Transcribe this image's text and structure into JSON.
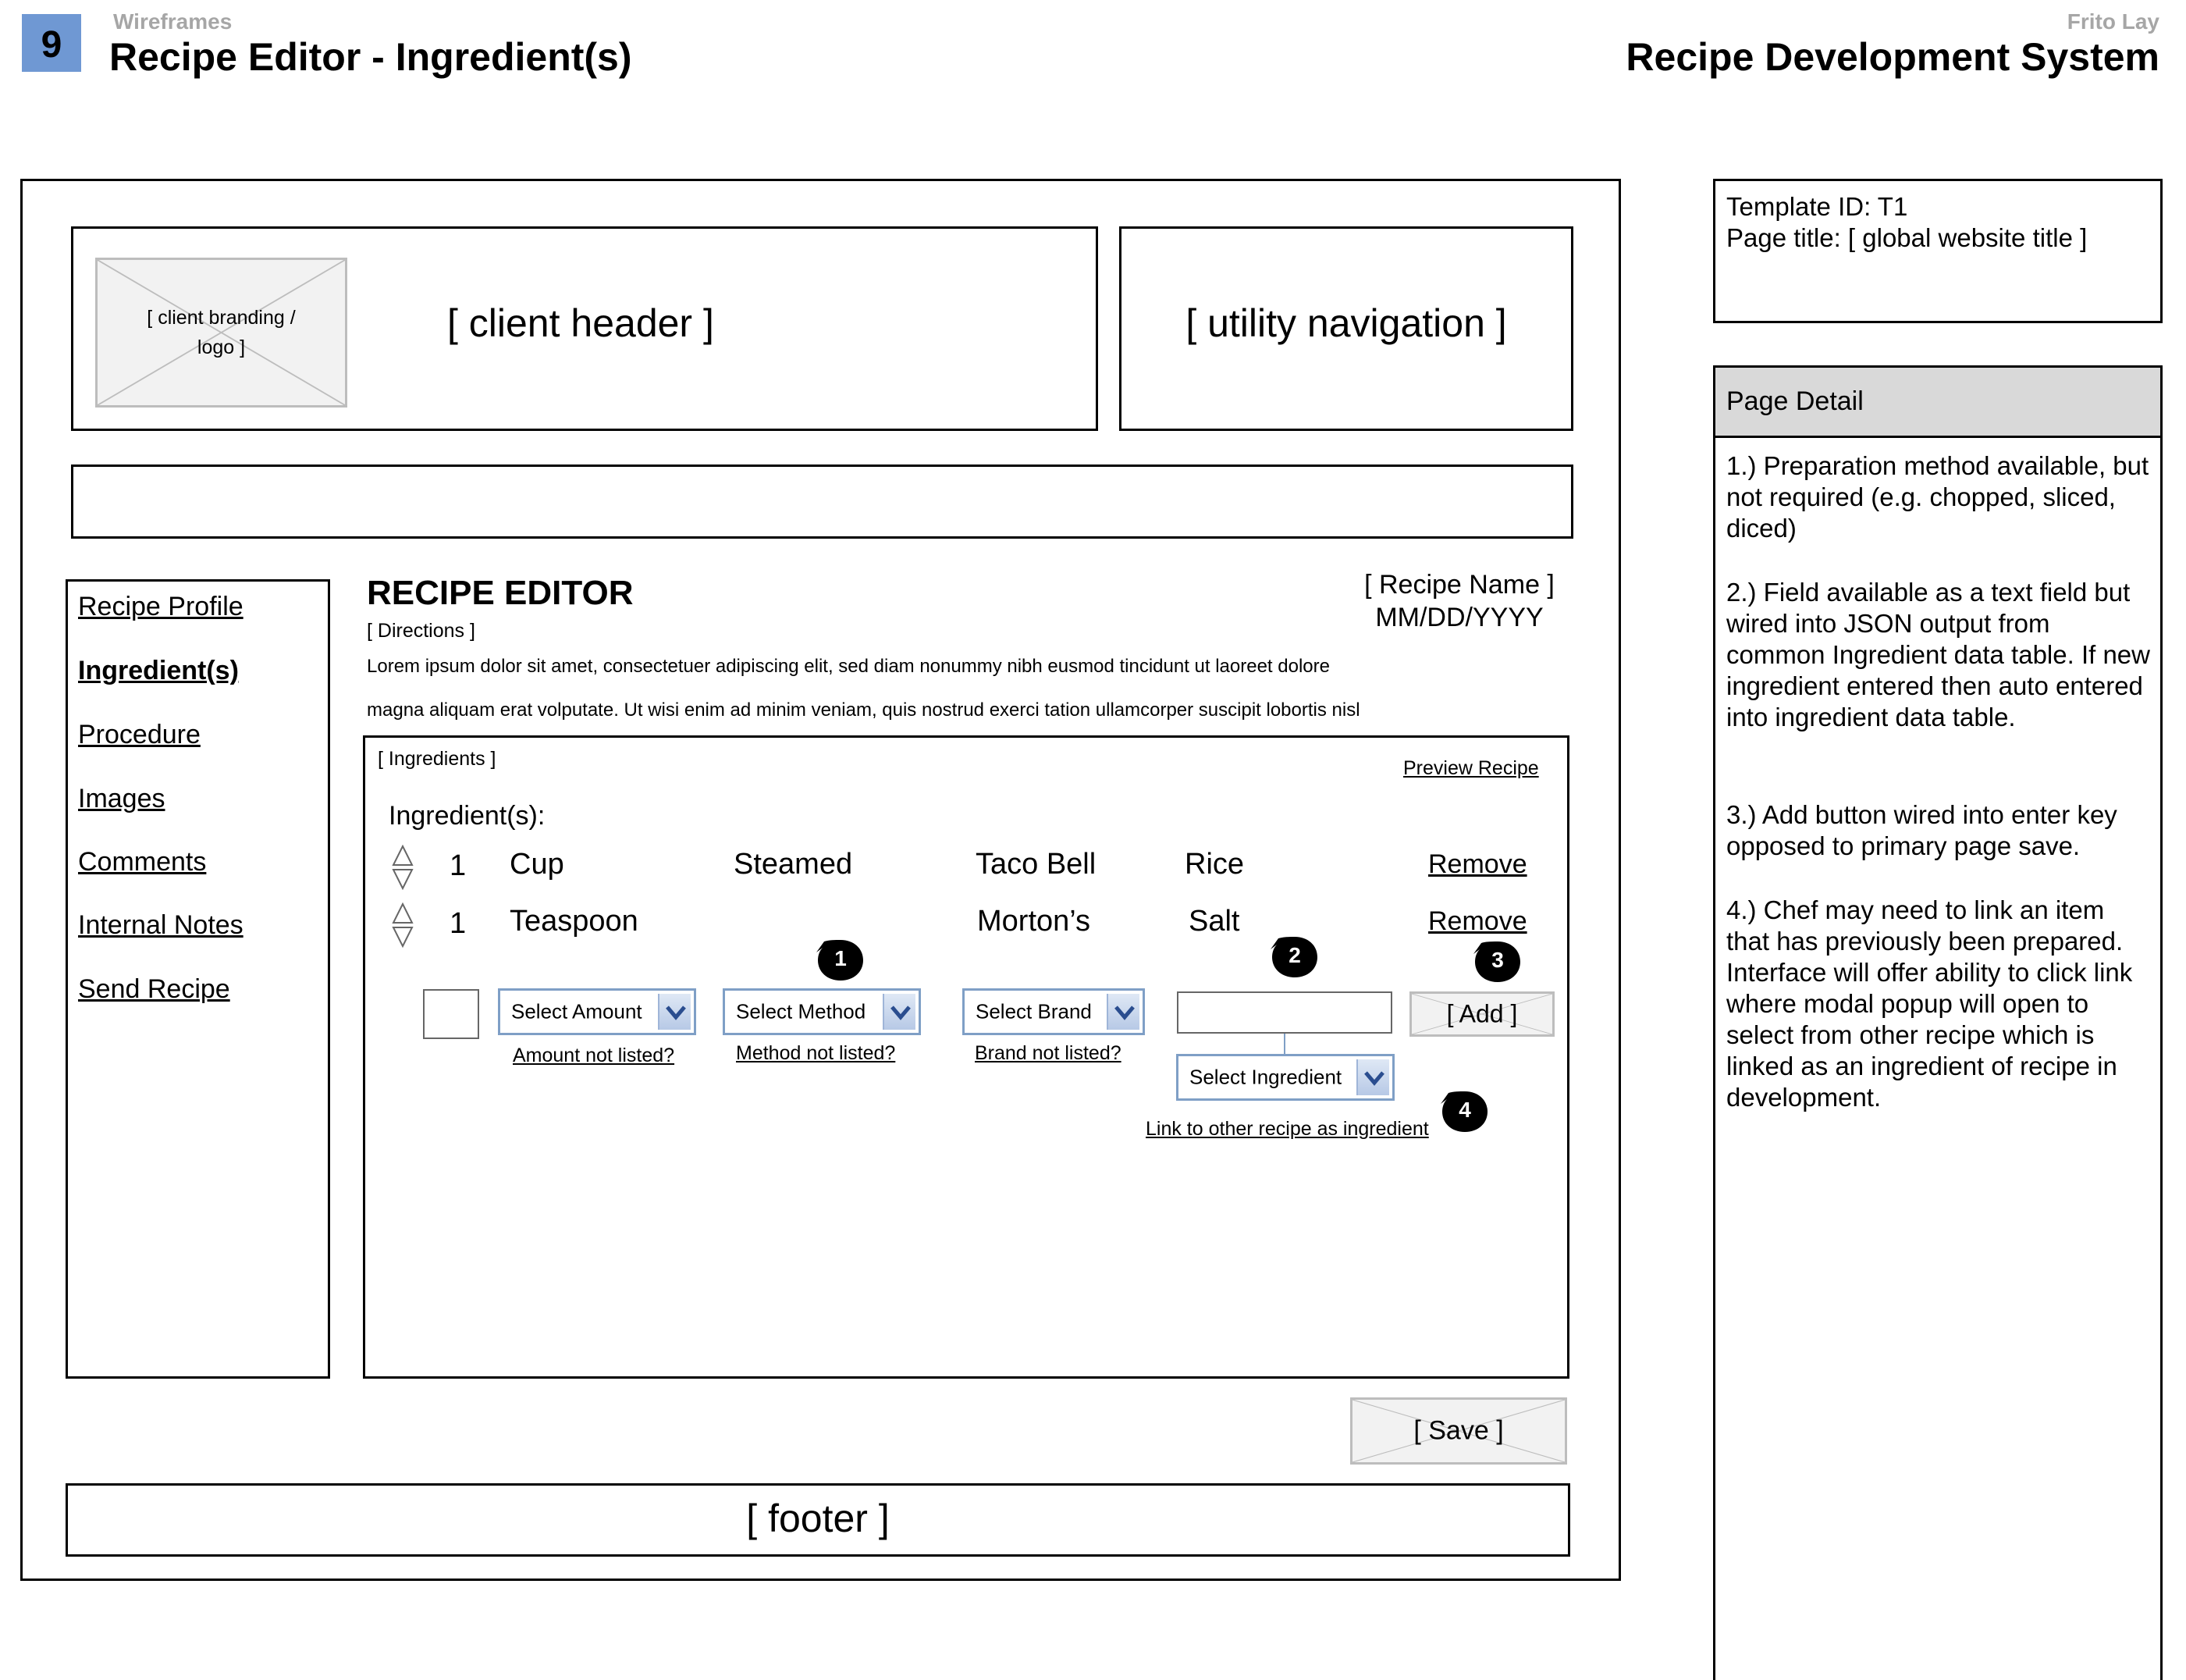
{
  "header": {
    "page_number": "9",
    "section": "Wireframes",
    "title": "Recipe Editor - Ingredient(s)",
    "client": "Frito Lay",
    "system": "Recipe Development System"
  },
  "wireframe": {
    "branding_placeholder": "[  client branding / logo ]",
    "client_header": "[ client header ]",
    "utility_navigation": "[ utility navigation ]",
    "footer": "[ footer ]",
    "save_button": "[ Save ]"
  },
  "sidebar": {
    "items": [
      {
        "label": "Recipe Profile",
        "active": false
      },
      {
        "label": "Ingredient(s)",
        "active": true
      },
      {
        "label": "Procedure",
        "active": false
      },
      {
        "label": "Images",
        "active": false
      },
      {
        "label": "Comments",
        "active": false
      },
      {
        "label": "Internal Notes",
        "active": false
      },
      {
        "label": "Send Recipe",
        "active": false
      }
    ]
  },
  "editor": {
    "heading": "RECIPE EDITOR",
    "directions_label": "[ Directions ]",
    "recipe_name": "[ Recipe Name ]",
    "date": "MM/DD/YYYY",
    "lorem_line1": "Lorem ipsum dolor sit amet, consectetuer adipiscing elit, sed diam nonummy nibh eusmod tincidunt ut laoreet dolore",
    "lorem_line2": "magna aliquam erat volputate. Ut wisi enim ad minim veniam, quis nostrud exerci tation ullamcorper suscipit lobortis nisl"
  },
  "ingredients_panel": {
    "label": "[ Ingredients ]",
    "preview_link": "Preview Recipe",
    "list_heading": "Ingredient(s):",
    "rows": [
      {
        "qty": "1",
        "unit": "Cup",
        "method": "Steamed",
        "brand": "Taco Bell",
        "ingredient": "Rice",
        "remove": "Remove"
      },
      {
        "qty": "1",
        "unit": "Teaspoon",
        "method": "",
        "brand": "Morton’s",
        "ingredient": "Salt",
        "remove": "Remove"
      }
    ],
    "form": {
      "qty_value": "",
      "amount_select": "Select Amount",
      "amount_link": "Amount not listed?",
      "method_select": "Select Method",
      "method_link": "Method not listed?",
      "brand_select": "Select Brand",
      "brand_link": "Brand not listed?",
      "ingredient_text_value": "",
      "ingredient_select": "Select Ingredient",
      "link_recipe": "Link to other recipe as ingredient",
      "add_button": "[ Add ]"
    },
    "badges": [
      "1",
      "2",
      "3",
      "4"
    ]
  },
  "right_panel": {
    "template_id": "Template ID: T1",
    "page_title": "Page title: [ global website title ]",
    "detail_heading": "Page Detail",
    "notes": [
      "1.) Preparation method available, but not required (e.g. chopped, sliced, diced)",
      "2.) Field available as a text field but wired into JSON output from common Ingredient data table. If new ingredient entered then auto entered into ingredient data table.",
      "3.) Add button wired into enter key opposed to primary page save.",
      "4.) Chef may need to link an item that has previously been prepared. Interface will offer ability to click link where modal popup will open to select from other recipe which is linked as an ingredient of recipe in development."
    ]
  },
  "colors": {
    "page_badge": "#6f98d3",
    "dropdown_border": "#7f9fc6",
    "placeholder_bg": "#f2f2f2",
    "detail_header_bg": "#d9d9d9"
  }
}
